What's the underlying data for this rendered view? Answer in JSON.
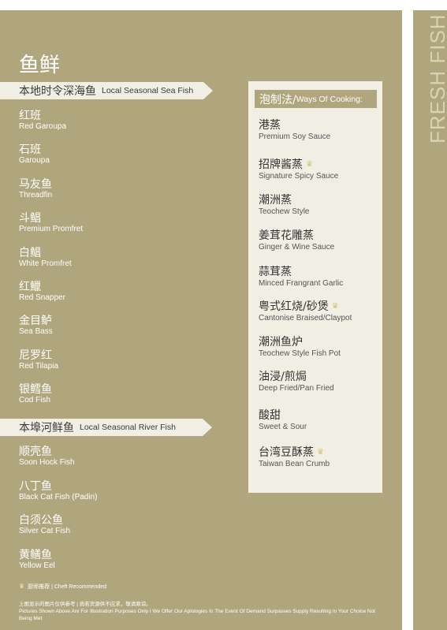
{
  "side_heading": "FRESH FISH",
  "title": "鱼鲜",
  "sea_section": {
    "label_zh": "本地时令深海鱼",
    "label_en": "Local Seasonal Sea Fish",
    "items": [
      {
        "zh": "红班",
        "en": "Red Garoupa"
      },
      {
        "zh": "石班",
        "en": "Garoupa"
      },
      {
        "zh": "马友鱼",
        "en": "Threadfin"
      },
      {
        "zh": "斗鲳",
        "en": "Premium Promfret"
      },
      {
        "zh": "白鲳",
        "en": "White Promfret"
      },
      {
        "zh": "红鱲",
        "en": "Red Snapper"
      },
      {
        "zh": "金目鲈",
        "en": "Sea Bass"
      },
      {
        "zh": "尼罗红",
        "en": "Red Tilapia"
      },
      {
        "zh": "银鳕鱼",
        "en": "Cod Fish"
      }
    ]
  },
  "river_section": {
    "label_zh": "本埠河鲜鱼",
    "label_en": "Local Seasonal River Fish",
    "items": [
      {
        "zh": "顺壳鱼",
        "en": "Soon Hock Fish"
      },
      {
        "zh": "八丁鱼",
        "en": "Black Cat Fish (Padin)"
      },
      {
        "zh": "白须公鱼",
        "en": "Silver Cat Fish"
      },
      {
        "zh": "黄鳝鱼",
        "en": "Yellow Eel"
      }
    ]
  },
  "cooking": {
    "header_zh": "泡制法/",
    "header_en": "Ways Of Cooking:",
    "methods": [
      {
        "zh": "港蒸",
        "en": "Premium Soy Sauce",
        "recommended": false
      },
      {
        "zh": "招牌酱蒸",
        "en": "Signature Spicy Sauce",
        "recommended": true
      },
      {
        "zh": "潮洲蒸",
        "en": "Teochew Style",
        "recommended": false
      },
      {
        "zh": "姜茸花雕蒸",
        "en": "Ginger & Wine Sauce",
        "recommended": false
      },
      {
        "zh": "蒜茸蒸",
        "en": "Minced Frangrant Garlic",
        "recommended": false
      },
      {
        "zh": "粤式红烧/砂煲",
        "en": "Cantonise Braised/Claypot",
        "recommended": true
      },
      {
        "zh": "潮洲鱼炉",
        "en": "Teochew Style Fish Pot",
        "recommended": false
      },
      {
        "zh": "油浸/煎焗",
        "en": "Deep Fried/Pan Fried",
        "recommended": false
      },
      {
        "zh": "酸甜",
        "en": "Sweet & Sour",
        "recommended": false
      },
      {
        "zh": "台湾豆酥蒸",
        "en": "Taiwan Bean Crumb",
        "recommended": true
      }
    ]
  },
  "legend": "厨师推荐 | Cheft Recommended",
  "disclaimer_zh": "上图显示的图片仅供参考 | 倘若货源供不应求，敬请原谅。",
  "disclaimer_en": "Pictures Shown Above Are For Illustration Purposes Only I We Offer Our Aplologies In The Event Of Demand Surpasses Supply Resulting In Your Choice Not Being Met",
  "colors": {
    "panel": "#b0a67e",
    "cream": "#f1eee4",
    "crown": "#d2c47a"
  },
  "icons": {
    "recommended": "crown-icon"
  }
}
